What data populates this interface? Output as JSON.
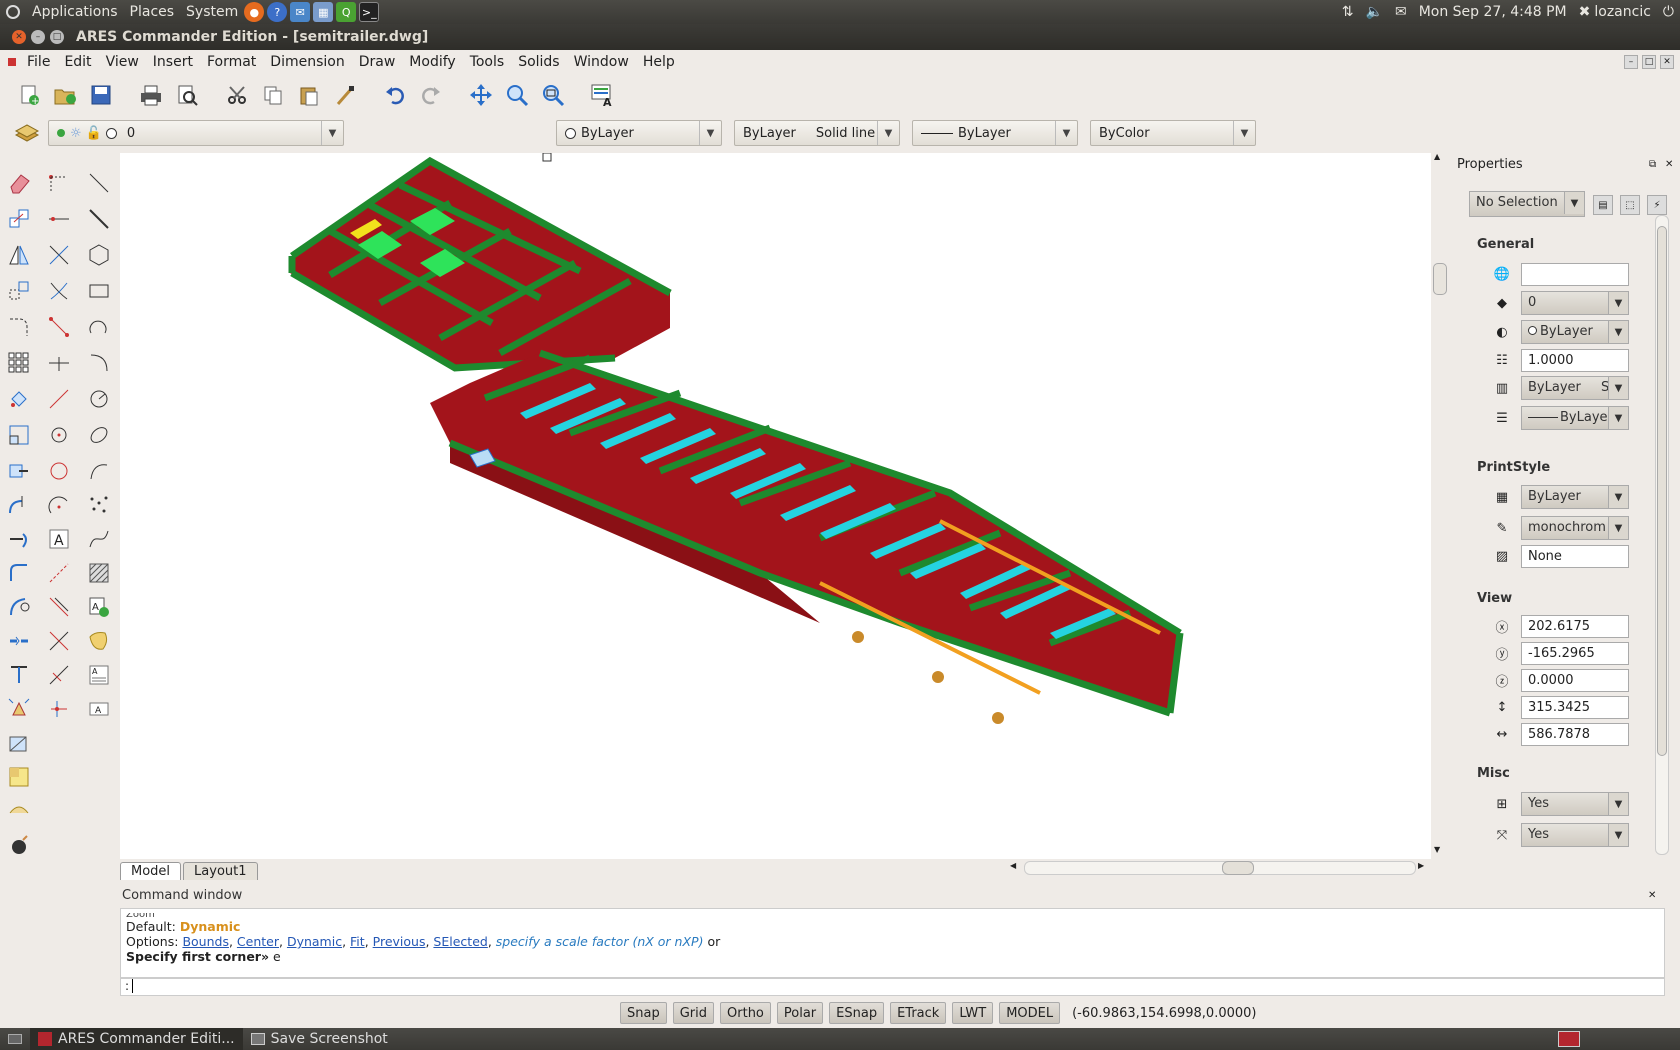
{
  "sys_panel": {
    "menus": [
      "Applications",
      "Places",
      "System"
    ],
    "clock": "Mon Sep 27, 4:48 PM",
    "user": "lozancic"
  },
  "window": {
    "title": "ARES Commander Edition - [semitrailer.dwg]"
  },
  "menu": [
    "File",
    "Edit",
    "View",
    "Insert",
    "Format",
    "Dimension",
    "Draw",
    "Modify",
    "Tools",
    "Solids",
    "Window",
    "Help"
  ],
  "layer_combo": {
    "value": "0"
  },
  "color_combo": {
    "value": "ByLayer"
  },
  "linetype_combo": {
    "value": "ByLayer",
    "value2": "Solid line"
  },
  "lineweight_combo": {
    "value": "ByLayer"
  },
  "plotstyle_combo": {
    "value": "ByColor"
  },
  "tabs": {
    "model": "Model",
    "layout": "Layout1"
  },
  "properties": {
    "title": "Properties",
    "selection": "No Selection",
    "general": {
      "label": "General",
      "layer": "0",
      "color": "ByLayer",
      "linetype_scale": "1.0000",
      "linetype": "ByLayer",
      "linetype_suffix": "S",
      "lineweight": "ByLaye"
    },
    "printstyle": {
      "label": "PrintStyle",
      "style": "ByLayer",
      "table": "monochrom",
      "attached": "None"
    },
    "view": {
      "label": "View",
      "center_x": "202.6175",
      "center_y": "-165.2965",
      "center_z": "0.0000",
      "height": "315.3425",
      "width": "586.7878"
    },
    "misc": {
      "label": "Misc",
      "v1": "Yes",
      "v2": "Yes"
    }
  },
  "command": {
    "title": "Command window",
    "line0": "Zoom",
    "default_label": "Default:",
    "default_value": "Dynamic",
    "options_label": "Options:",
    "opt_bounds": "Bounds",
    "opt_center": "Center",
    "opt_dynamic": "Dynamic",
    "opt_fit": "Fit",
    "opt_previous": "Previous",
    "opt_selected": "SElected",
    "opt_scale": "specify a scale factor (nX or nXP)",
    "opt_or": "or",
    "prompt": "Specify first corner»",
    "prompt_input": "e",
    "input_prefix": ":"
  },
  "status": {
    "buttons": [
      "Snap",
      "Grid",
      "Ortho",
      "Polar",
      "ESnap",
      "ETrack",
      "LWT",
      "MODEL"
    ],
    "coords": "(-60.9863,154.6998,0.0000)"
  },
  "taskbar": {
    "task1": "ARES Commander Editi...",
    "task2": "Save Screenshot"
  },
  "colors": {
    "frame_green": "#1e8a2e",
    "panel_red": "#a3141b",
    "crossmember_cyan": "#25d3e0",
    "axle_orange": "#f2a020"
  }
}
